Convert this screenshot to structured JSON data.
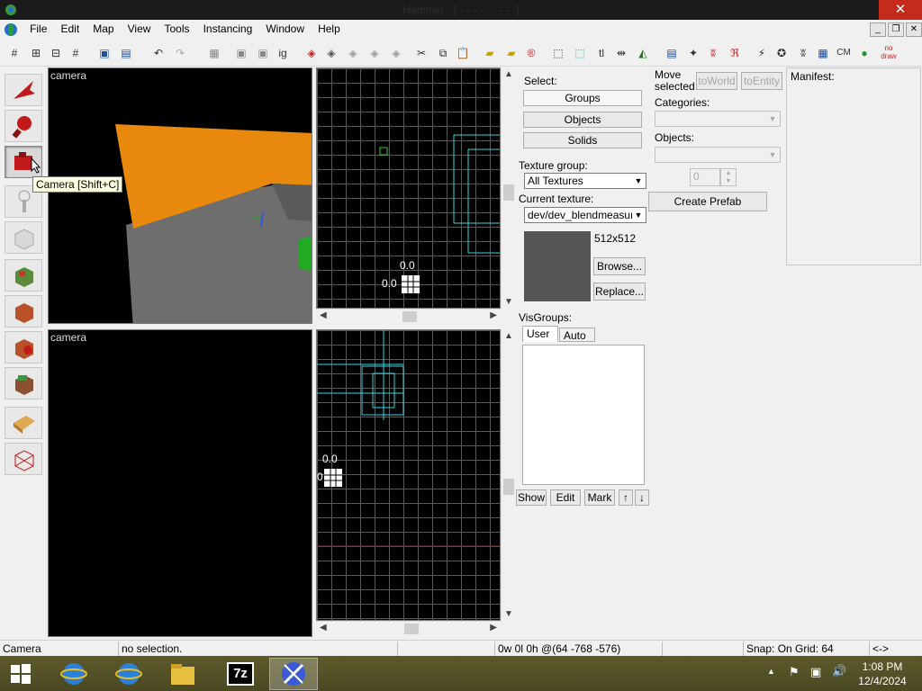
{
  "window": {
    "title": "Hammer - [ - - - - -  - - - -]",
    "close_glyph": "✕",
    "min_glyph": "_",
    "restore_glyph": "❐",
    "close2_glyph": "✕"
  },
  "menu": [
    "File",
    "Edit",
    "Map",
    "View",
    "Tools",
    "Instancing",
    "Window",
    "Help"
  ],
  "toolbar_icons": [
    "grid-icon",
    "grid-smaller-icon",
    "grid-larger-icon",
    "grid-3d-icon",
    "group-icon",
    "ungroup-icon",
    "undo-icon",
    "redo-icon",
    "carve-icon",
    "hide-icon",
    "show-icon",
    "move-icon",
    "ignore-groups-icon",
    "cut-icon",
    "copy-icon",
    "paste-icon",
    "texture-lock-icon",
    "texture-scale-icon",
    "texture-app-icon",
    "select-icon",
    "texture-lock2-icon",
    "tl-icon",
    "flip-icon",
    "mirror-icon",
    "show-2d-icon",
    "3d-grid-icon",
    "ow-icon",
    "fr-icon",
    "snap-icon",
    "radius-icon",
    "sw-icon",
    "cube-icon",
    "cm-label",
    "run-icon",
    "nodraw-icon"
  ],
  "toolbar_text": {
    "ig": "ig",
    "tl": "tl",
    "cm": "CM",
    "nodraw": "no draw"
  },
  "tools": [
    {
      "name": "selection-tool-icon",
      "active": false
    },
    {
      "name": "magnify-tool-icon",
      "active": false
    },
    {
      "name": "camera-tool-icon",
      "active": true
    },
    {
      "name": "entity-tool-icon",
      "active": false
    },
    {
      "name": "block-tool-icon",
      "active": false
    },
    {
      "name": "texture-tool-icon",
      "active": false
    },
    {
      "name": "apply-texture-icon",
      "active": false
    },
    {
      "name": "decal-tool-icon",
      "active": false
    },
    {
      "name": "overlay-tool-icon",
      "active": false
    },
    {
      "name": "clip-tool-icon",
      "active": false
    },
    {
      "name": "vertex-tool-icon",
      "active": false
    }
  ],
  "tooltip": "Camera [Shift+C]",
  "viewports": {
    "top_left_label": "camera",
    "bottom_left_label": "camera",
    "top_right": {
      "coord_x": "0.0",
      "coord_y": "0.0"
    },
    "bottom_right": {
      "coord_x": "0.0",
      "coord_y": "0"
    }
  },
  "select_panel": {
    "label": "Select:",
    "groups": "Groups",
    "objects": "Objects",
    "solids": "Solids"
  },
  "texture_panel": {
    "group_label": "Texture group:",
    "group_value": "All Textures",
    "current_label": "Current texture:",
    "current_value": "dev/dev_blendmeasure",
    "size": "512x512",
    "browse": "Browse...",
    "replace": "Replace..."
  },
  "visgroups": {
    "label": "VisGroups:",
    "tabs": [
      "User",
      "Auto"
    ],
    "show": "Show",
    "edit": "Edit",
    "mark": "Mark",
    "up": "↑",
    "down": "↓"
  },
  "move_panel": {
    "label": "Move selected:",
    "to_world": "toWorld",
    "to_entity": "toEntity",
    "categories_label": "Categories:",
    "objects_label": "Objects:",
    "spin_value": "0",
    "create_prefab": "Create Prefab"
  },
  "manifest": {
    "label": "Manifest:"
  },
  "status": {
    "mode": "Camera",
    "selection": "no selection.",
    "coords": "0w 0l 0h @(64 -768 -576)",
    "snap": "Snap: On Grid: 64",
    "arrows": "<->"
  },
  "taskbar": {
    "apps": [
      "ie-icon",
      "ie-icon",
      "file-explorer-icon",
      "7zip-icon",
      "hammer-icon"
    ],
    "sevenzip": "7z",
    "time": "1:08 PM",
    "date": "12/4/2024"
  },
  "colors": {
    "orange": "#e8880c",
    "gray": "#6e6e6e",
    "selection_cyan": "#39d4e0",
    "grid": "#5a5a5a"
  }
}
